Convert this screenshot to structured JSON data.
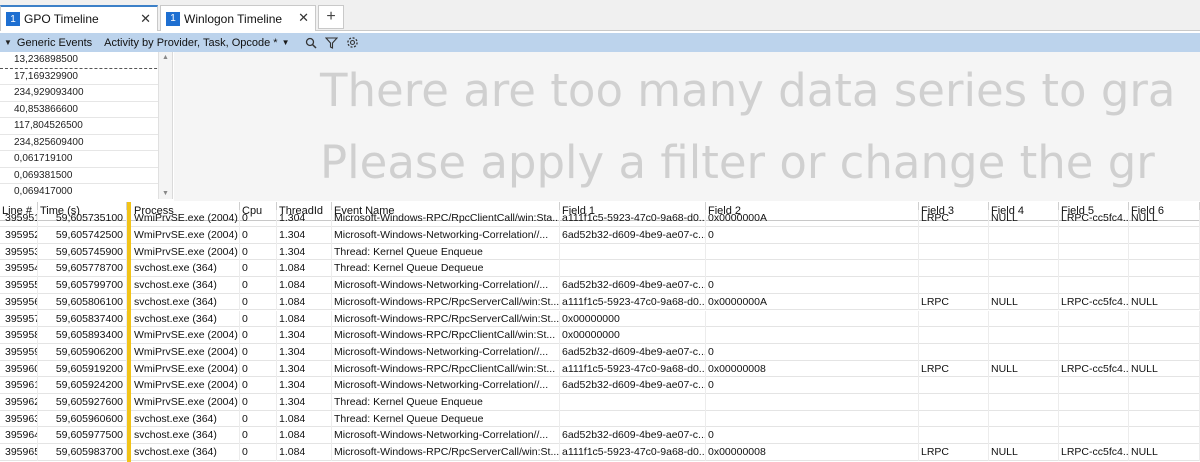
{
  "tabs": [
    {
      "number": "1",
      "title": "GPO Timeline",
      "close": "✕",
      "active": true
    },
    {
      "number": "1",
      "title": "Winlogon Timeline",
      "close": "✕",
      "active": false
    }
  ],
  "new_tab_label": "+",
  "toolbar": {
    "collapse_glyph": "▼",
    "series_label": "Generic Events",
    "preset_label": "Activity by Provider, Task, Opcode *",
    "preset_dropdown_glyph": "▼",
    "icons": [
      "search-icon",
      "filter-icon",
      "settings-gear-icon"
    ]
  },
  "legend": {
    "values": [
      "13,236898500",
      "17,169329900",
      "234,929093400",
      "40,853866600",
      "117,804526500",
      "234,825609400",
      "0,061719100",
      "0,069381500",
      "0,069417000"
    ],
    "scroll_up": "▲",
    "scroll_down": "▼"
  },
  "graph": {
    "message_line1": "There are too many data series to gra",
    "message_line2": "Please apply a filter or change the gr"
  },
  "table": {
    "columns": [
      "Line #",
      "Time (s)",
      "Process",
      "Cpu",
      "ThreadId",
      "Event Name",
      "Field 1",
      "Field 2",
      "Field 3",
      "Field 4",
      "Field 5",
      "Field 6"
    ],
    "partial_row": [
      "395951",
      "59,605735100",
      "WmiPrvSE.exe (2004)",
      "0",
      "1.304",
      "Microsoft-Windows-RPC/RpcClientCall/win:Sta...",
      "a111f1c5-5923-47c0-9a68-d0...",
      "0x0000000A",
      "LRPC",
      "NULL",
      "LRPC-cc5fc4...",
      "NULL"
    ],
    "rows": [
      [
        "395952",
        "59,605742500",
        "WmiPrvSE.exe (2004)",
        "0",
        "1.304",
        "Microsoft-Windows-Networking-Correlation//...",
        "6ad52b32-d609-4be9-ae07-c...",
        "0",
        "",
        "",
        "",
        ""
      ],
      [
        "395953",
        "59,605745900",
        "WmiPrvSE.exe (2004)",
        "0",
        "1.304",
        "Thread: Kernel Queue Enqueue",
        "",
        "",
        "",
        "",
        "",
        ""
      ],
      [
        "395954",
        "59,605778700",
        "svchost.exe (364)",
        "0",
        "1.084",
        "Thread: Kernel Queue Dequeue",
        "",
        "",
        "",
        "",
        "",
        ""
      ],
      [
        "395955",
        "59,605799700",
        "svchost.exe (364)",
        "0",
        "1.084",
        "Microsoft-Windows-Networking-Correlation//...",
        "6ad52b32-d609-4be9-ae07-c...",
        "0",
        "",
        "",
        "",
        ""
      ],
      [
        "395956",
        "59,605806100",
        "svchost.exe (364)",
        "0",
        "1.084",
        "Microsoft-Windows-RPC/RpcServerCall/win:St...",
        "a111f1c5-5923-47c0-9a68-d0...",
        "0x0000000A",
        "LRPC",
        "NULL",
        "LRPC-cc5fc4...",
        "NULL"
      ],
      [
        "395957",
        "59,605837400",
        "svchost.exe (364)",
        "0",
        "1.084",
        "Microsoft-Windows-RPC/RpcServerCall/win:St...",
        "0x00000000",
        "",
        "",
        "",
        "",
        ""
      ],
      [
        "395958",
        "59,605893400",
        "WmiPrvSE.exe (2004)",
        "0",
        "1.304",
        "Microsoft-Windows-RPC/RpcClientCall/win:St...",
        "0x00000000",
        "",
        "",
        "",
        "",
        ""
      ],
      [
        "395959",
        "59,605906200",
        "WmiPrvSE.exe (2004)",
        "0",
        "1.304",
        "Microsoft-Windows-Networking-Correlation//...",
        "6ad52b32-d609-4be9-ae07-c...",
        "0",
        "",
        "",
        "",
        ""
      ],
      [
        "395960",
        "59,605919200",
        "WmiPrvSE.exe (2004)",
        "0",
        "1.304",
        "Microsoft-Windows-RPC/RpcClientCall/win:St...",
        "a111f1c5-5923-47c0-9a68-d0...",
        "0x00000008",
        "LRPC",
        "NULL",
        "LRPC-cc5fc4...",
        "NULL"
      ],
      [
        "395961",
        "59,605924200",
        "WmiPrvSE.exe (2004)",
        "0",
        "1.304",
        "Microsoft-Windows-Networking-Correlation//...",
        "6ad52b32-d609-4be9-ae07-c...",
        "0",
        "",
        "",
        "",
        ""
      ],
      [
        "395962",
        "59,605927600",
        "WmiPrvSE.exe (2004)",
        "0",
        "1.304",
        "Thread: Kernel Queue Enqueue",
        "",
        "",
        "",
        "",
        "",
        ""
      ],
      [
        "395963",
        "59,605960600",
        "svchost.exe (364)",
        "0",
        "1.084",
        "Thread: Kernel Queue Dequeue",
        "",
        "",
        "",
        "",
        "",
        ""
      ],
      [
        "395964",
        "59,605977500",
        "svchost.exe (364)",
        "0",
        "1.084",
        "Microsoft-Windows-Networking-Correlation//...",
        "6ad52b32-d609-4be9-ae07-c...",
        "0",
        "",
        "",
        "",
        ""
      ],
      [
        "395965",
        "59,605983700",
        "svchost.exe (364)",
        "0",
        "1.084",
        "Microsoft-Windows-RPC/RpcServerCall/win:St...",
        "a111f1c5-5923-47c0-9a68-d0...",
        "0x00000008",
        "LRPC",
        "NULL",
        "LRPC-cc5fc4...",
        "NULL"
      ]
    ]
  }
}
